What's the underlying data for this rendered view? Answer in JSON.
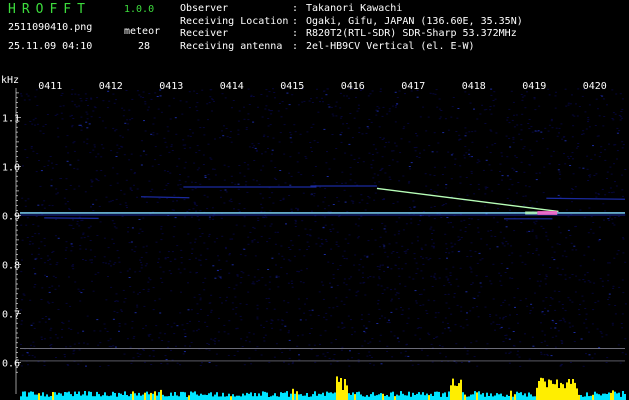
{
  "header": {
    "app_title": "HROFFT",
    "app_version": "1.0.0",
    "filename": "2511090410.png",
    "datetime": "25.11.09 04:10",
    "meteor_label": "meteor",
    "meteor_count": "28"
  },
  "info": [
    {
      "key": "Observer",
      "sep": ":",
      "value": "Takanori Kawachi"
    },
    {
      "key": "Receiving Location",
      "sep": ":",
      "value": "Ogaki, Gifu, JAPAN (136.60E, 35.35N)"
    },
    {
      "key": "Receiver",
      "sep": ":",
      "value": "R820T2(RTL-SDR) SDR-Sharp 53.372MHz"
    },
    {
      "key": "Receiving antenna",
      "sep": ":",
      "value": "2el-HB9CV Vertical (el. E-W)"
    }
  ],
  "spectrogram": {
    "unit": "kHz",
    "time_labels": [
      "0411",
      "0412",
      "0413",
      "0414",
      "0415",
      "0416",
      "0417",
      "0418",
      "0419",
      "0420"
    ],
    "freq_labels": [
      "1.1",
      "1.0",
      "0.9",
      "0.8",
      "0.7",
      "0.6"
    ],
    "freq_ticks_khz": [
      1.1,
      1.0,
      0.9,
      0.8,
      0.7,
      0.6
    ],
    "time_ticks_min": [
      1,
      2,
      3,
      4,
      5,
      6,
      7,
      8,
      9,
      10
    ],
    "freq_range_khz": [
      0.56,
      1.16
    ],
    "time_range_min": [
      0.5,
      10.5
    ],
    "carrier_freq_khz": 0.905,
    "colors": {
      "background": "#000000",
      "noise_low": "#06063a",
      "noise_mid": "#1a2aa0",
      "carrier": "#7fd8ff",
      "trace": "#b8ffb8",
      "hot": "#ff66cc",
      "level": "#00e5ff",
      "level_peak": "#ffee00",
      "axis_text": "#ffffff",
      "title": "#3ddc3d",
      "gridline": "#9090a0"
    }
  }
}
